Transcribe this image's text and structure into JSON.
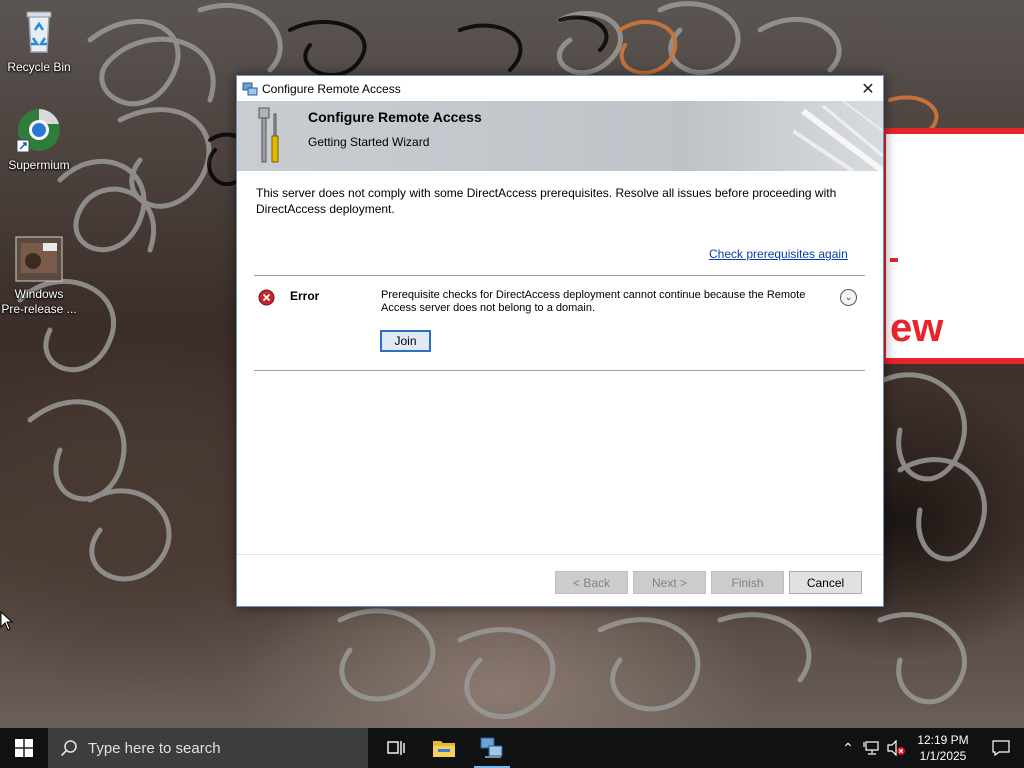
{
  "desktop": {
    "icons": [
      {
        "label": "Recycle Bin",
        "icon": "recycle-bin-icon"
      },
      {
        "label": "Supermium",
        "icon": "browser-icon"
      },
      {
        "label": "Windows\nPre-release ...",
        "icon": "image-file-icon"
      }
    ],
    "banner_text": "ew"
  },
  "dialog": {
    "window_title": "Configure Remote Access",
    "header_title": "Configure Remote Access",
    "header_subtitle": "Getting Started Wizard",
    "message": "This server does not comply with some DirectAccess prerequisites. Resolve all issues before proceeding with DirectAccess deployment.",
    "recheck_link": "Check prerequisites again",
    "error": {
      "label": "Error",
      "text": "Prerequisite checks for DirectAccess deployment cannot continue because the Remote Access server does not belong to a domain.",
      "action_label": "Join"
    },
    "buttons": {
      "back": "< Back",
      "next": "Next >",
      "finish": "Finish",
      "cancel": "Cancel"
    },
    "accent_color": "#2f6fbf",
    "link_color": "#0a3ba8",
    "error_color": "#c4262e"
  },
  "taskbar": {
    "search_placeholder": "Type here to search",
    "clock_time": "12:19 PM",
    "clock_date": "1/1/2025",
    "pinned": [
      "task-view-icon",
      "file-explorer-icon",
      "remote-access-icon"
    ],
    "background": "#101112"
  }
}
